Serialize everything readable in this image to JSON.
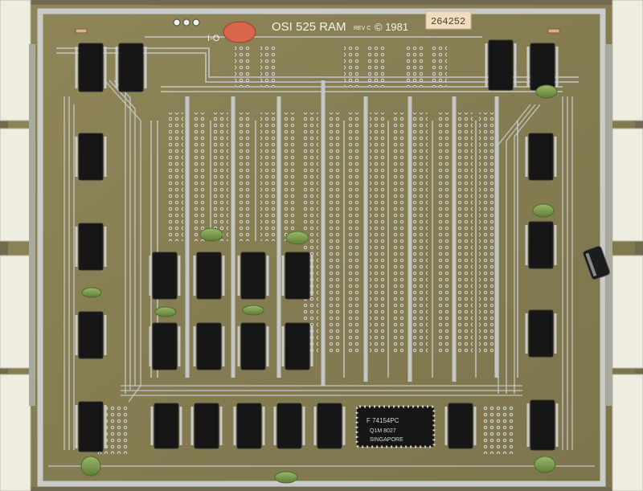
{
  "board": {
    "title": "OSI 525 RAM",
    "rev": "REV C",
    "copyright": "© 1981",
    "serial": "264252",
    "io_label": "I-O"
  },
  "large_chip": {
    "line1": "F 74154PC",
    "line2": "Q1M 8027",
    "line3": "SINGAPORE"
  },
  "colors": {
    "board": "#8a8055",
    "trace": "#c4c6c4",
    "chip": "#161616",
    "capacitor": "#7a9a4a",
    "connector": "#efece0"
  }
}
